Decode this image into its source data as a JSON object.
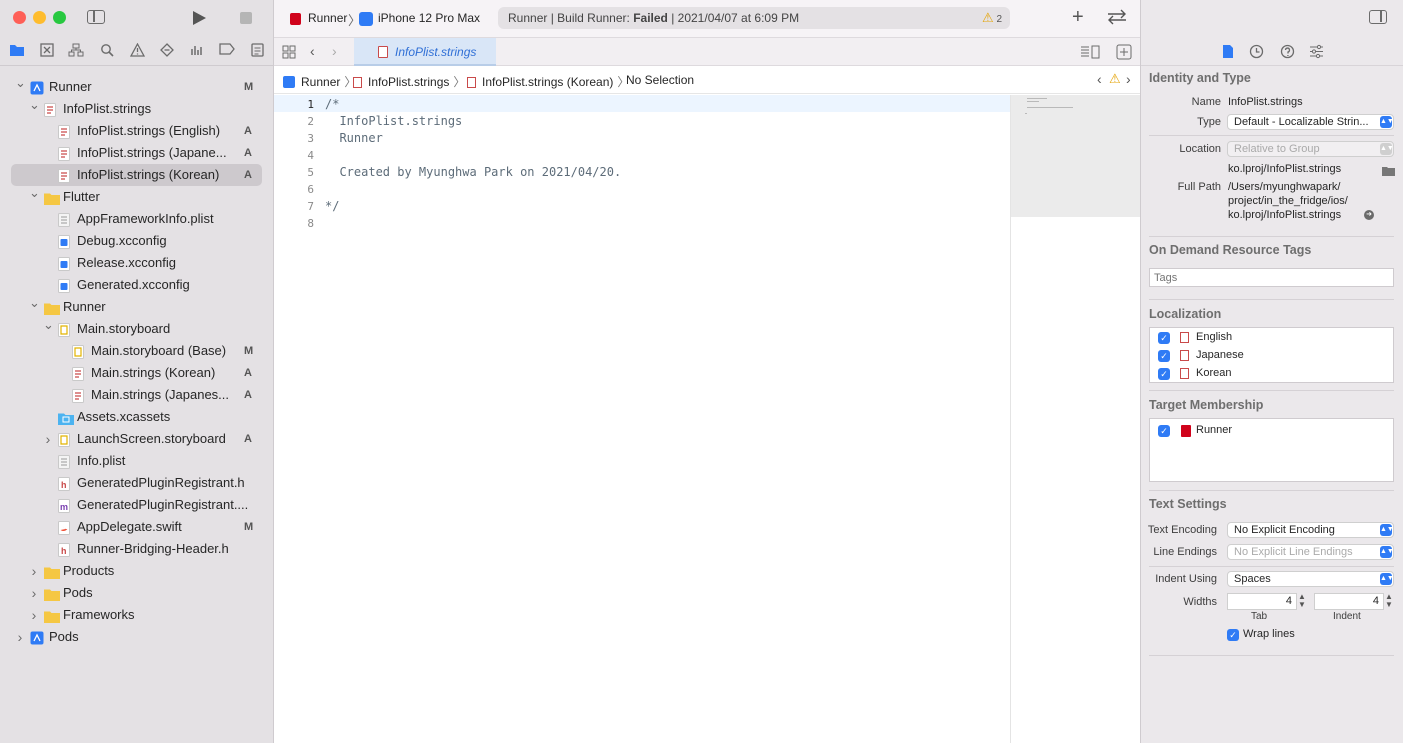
{
  "window": {
    "scheme": "Runner",
    "device": "iPhone 12 Pro Max",
    "status_prefix": "Runner | Build Runner: ",
    "status_result": "Failed",
    "status_time": " | 2021/04/07 at 6:09 PM",
    "warning_count": "2"
  },
  "tab": {
    "label": "InfoPlist.strings"
  },
  "jumpbar": {
    "items": [
      "Runner",
      "InfoPlist.strings",
      "InfoPlist.strings (Korean)",
      "No Selection"
    ]
  },
  "navigator": {
    "items": [
      {
        "label": "Runner",
        "status": "M"
      },
      {
        "label": "InfoPlist.strings",
        "status": ""
      },
      {
        "label": "InfoPlist.strings (English)",
        "status": "A"
      },
      {
        "label": "InfoPlist.strings (Japane...",
        "status": "A"
      },
      {
        "label": "InfoPlist.strings (Korean)",
        "status": "A"
      },
      {
        "label": "Flutter",
        "status": ""
      },
      {
        "label": "AppFrameworkInfo.plist",
        "status": ""
      },
      {
        "label": "Debug.xcconfig",
        "status": ""
      },
      {
        "label": "Release.xcconfig",
        "status": ""
      },
      {
        "label": "Generated.xcconfig",
        "status": ""
      },
      {
        "label": "Runner",
        "status": ""
      },
      {
        "label": "Main.storyboard",
        "status": ""
      },
      {
        "label": "Main.storyboard (Base)",
        "status": "M"
      },
      {
        "label": "Main.strings (Korean)",
        "status": "A"
      },
      {
        "label": "Main.strings (Japanes...",
        "status": "A"
      },
      {
        "label": "Assets.xcassets",
        "status": ""
      },
      {
        "label": "LaunchScreen.storyboard",
        "status": "A"
      },
      {
        "label": "Info.plist",
        "status": ""
      },
      {
        "label": "GeneratedPluginRegistrant.h",
        "status": ""
      },
      {
        "label": "GeneratedPluginRegistrant....",
        "status": ""
      },
      {
        "label": "AppDelegate.swift",
        "status": "M"
      },
      {
        "label": "Runner-Bridging-Header.h",
        "status": ""
      },
      {
        "label": "Products",
        "status": ""
      },
      {
        "label": "Pods",
        "status": ""
      },
      {
        "label": "Frameworks",
        "status": ""
      },
      {
        "label": "Pods",
        "status": ""
      }
    ]
  },
  "editor": {
    "line_numbers": [
      "1",
      "2",
      "3",
      "4",
      "5",
      "6",
      "7",
      "8"
    ],
    "lines": [
      "/*",
      "  InfoPlist.strings",
      "  Runner",
      "",
      "  Created by Myunghwa Park on 2021/04/20.",
      "",
      "*/",
      ""
    ]
  },
  "inspector": {
    "identity_title": "Identity and Type",
    "name_label": "Name",
    "name_value": "InfoPlist.strings",
    "type_label": "Type",
    "type_value": "Default - Localizable Strin...",
    "location_label": "Location",
    "location_value": "Relative to Group",
    "location_path": "ko.lproj/InfoPlist.strings",
    "fullpath_label": "Full Path",
    "fullpath_1": "/Users/myunghwapark/",
    "fullpath_2": "project/in_the_fridge/ios/",
    "fullpath_3": "ko.lproj/InfoPlist.strings",
    "odr_title": "On Demand Resource Tags",
    "tags_placeholder": "Tags",
    "localization_title": "Localization",
    "languages": [
      "English",
      "Japanese",
      "Korean"
    ],
    "target_title": "Target Membership",
    "target": "Runner",
    "text_settings_title": "Text Settings",
    "encoding_label": "Text Encoding",
    "encoding_value": "No Explicit Encoding",
    "endings_label": "Line Endings",
    "endings_value": "No Explicit Line Endings",
    "indent_using_label": "Indent Using",
    "indent_using_value": "Spaces",
    "widths_label": "Widths",
    "tab_width": "4",
    "indent_width": "4",
    "tab_caption": "Tab",
    "indent_caption": "Indent",
    "wrap_label": "Wrap lines"
  },
  "colors": {
    "accent": "#2f7bf5",
    "selection": "#cdc9cd",
    "folder": "#f5c743",
    "error": "#d0021b"
  }
}
